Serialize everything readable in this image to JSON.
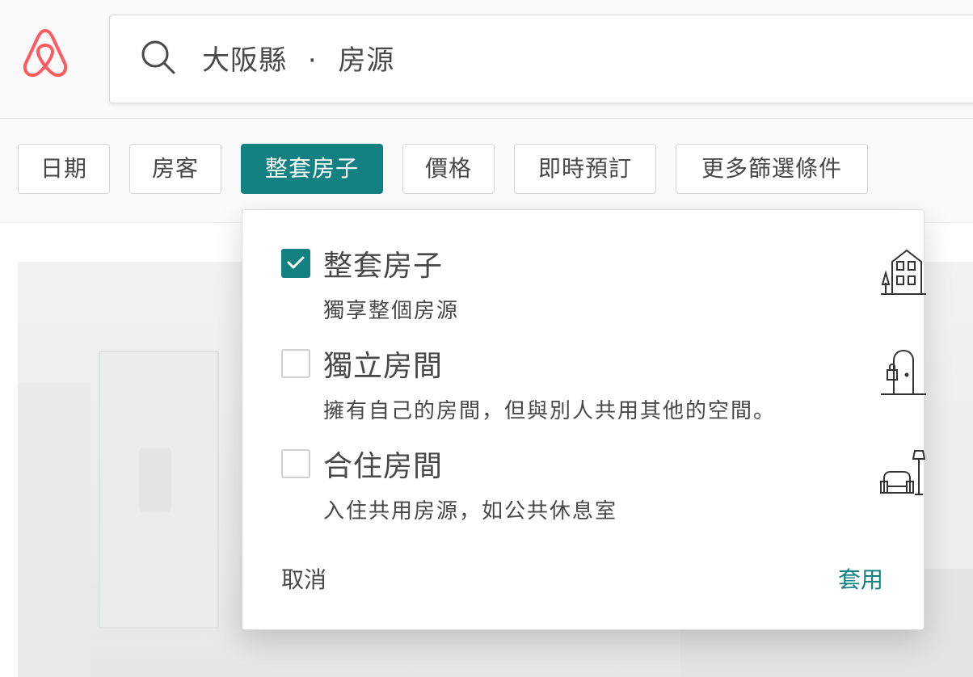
{
  "header": {
    "logo_icon": "airbnb-logo-icon",
    "search": {
      "icon": "search-icon",
      "location": "大阪縣",
      "separator": "·",
      "category": "房源"
    }
  },
  "filters": [
    {
      "label": "日期",
      "active": false
    },
    {
      "label": "房客",
      "active": false
    },
    {
      "label": "整套房子",
      "active": true
    },
    {
      "label": "價格",
      "active": false
    },
    {
      "label": "即時預訂",
      "active": false
    },
    {
      "label": "更多篩選條件",
      "active": false
    }
  ],
  "room_type_panel": {
    "options": [
      {
        "title": "整套房子",
        "description": "獨享整個房源",
        "checked": true,
        "icon": "house-icon"
      },
      {
        "title": "獨立房間",
        "description": "擁有自己的房間，但與別人共用其他的空間。",
        "checked": false,
        "icon": "private-door-icon"
      },
      {
        "title": "合住房間",
        "description": "入住共用房源，如公共休息室",
        "checked": false,
        "icon": "armchair-lamp-icon"
      }
    ],
    "cancel_label": "取消",
    "apply_label": "套用"
  },
  "colors": {
    "brand": "#FF5A5F",
    "accent": "#138181",
    "text": "#484848"
  }
}
